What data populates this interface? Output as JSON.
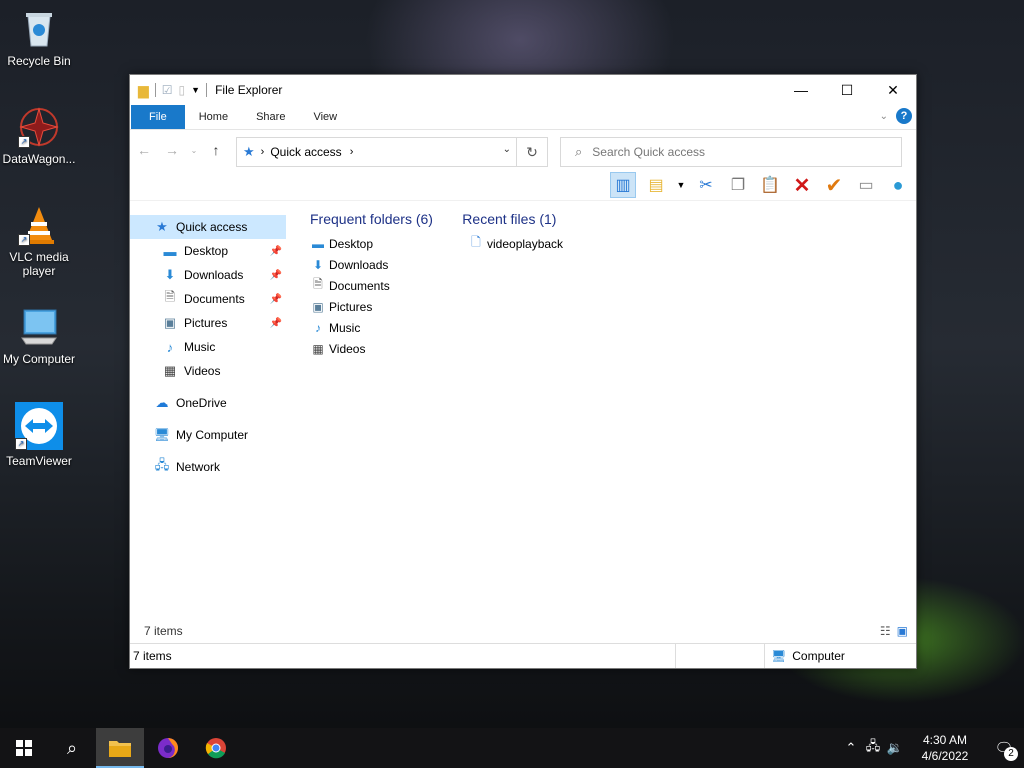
{
  "desktop": {
    "icons": [
      {
        "label": "Recycle Bin",
        "icon": "recycle-bin-icon"
      },
      {
        "label": "DataWagon...",
        "icon": "datawagon-icon"
      },
      {
        "label": "VLC media player",
        "icon": "vlc-icon"
      },
      {
        "label": "My Computer",
        "icon": "computer-icon"
      },
      {
        "label": "TeamViewer",
        "icon": "teamviewer-icon"
      }
    ]
  },
  "window": {
    "title": "File Explorer",
    "tabs": [
      "File",
      "Home",
      "Share",
      "View"
    ],
    "address": {
      "crumb": "Quick access"
    },
    "search": {
      "placeholder": "Search Quick access"
    },
    "nav": {
      "quick_access": "Quick access",
      "items": [
        "Desktop",
        "Downloads",
        "Documents",
        "Pictures",
        "Music",
        "Videos"
      ],
      "onedrive": "OneDrive",
      "my_computer": "My Computer",
      "network": "Network"
    },
    "content": {
      "frequent_header": "Frequent folders (6)",
      "recent_header": "Recent files (1)",
      "folders": [
        "Desktop",
        "Downloads",
        "Documents",
        "Pictures",
        "Music",
        "Videos"
      ],
      "recent_files": [
        "videoplayback"
      ]
    },
    "item_count": "7 items",
    "status": {
      "count": "7 items",
      "location": "Computer"
    }
  },
  "taskbar": {
    "time": "4:30 AM",
    "date": "4/6/2022",
    "notifications": "2"
  }
}
